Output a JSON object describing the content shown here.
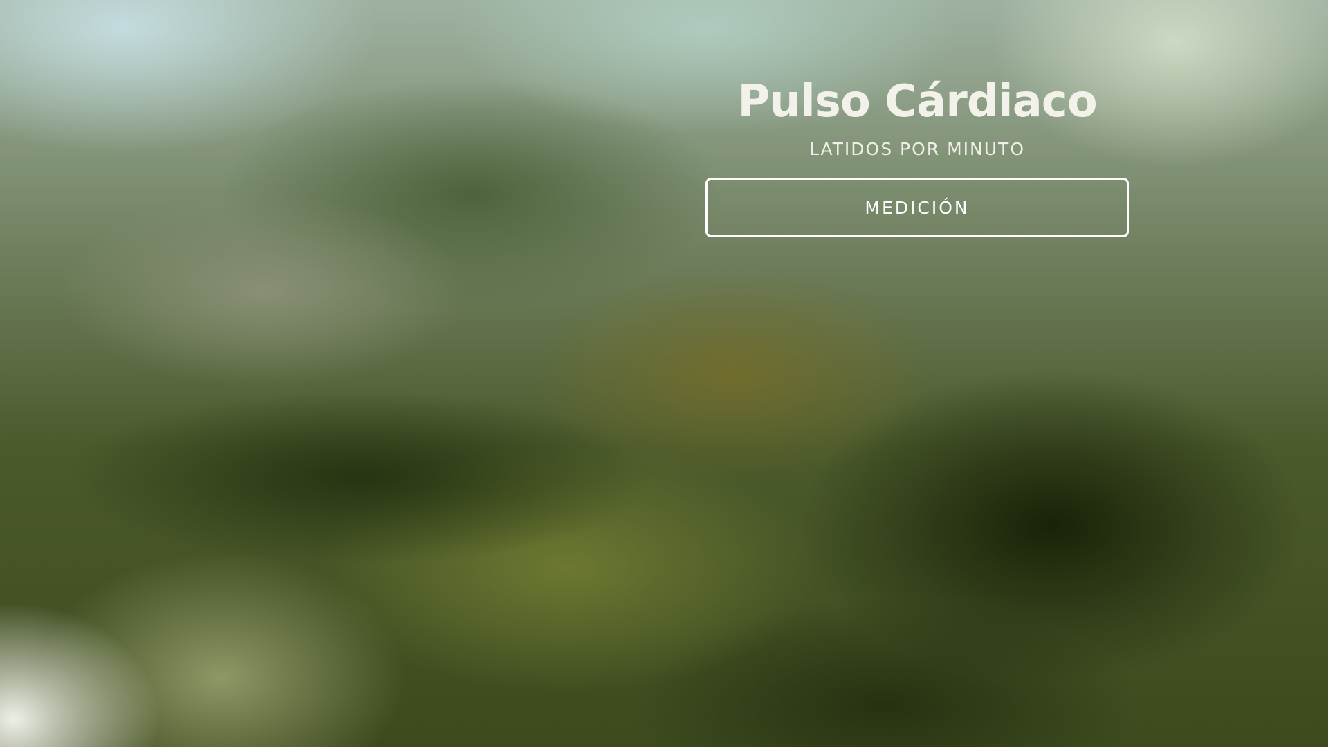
{
  "heart_rate": {
    "title": "Pulso Cárdiaco",
    "subtitle": "LATIDOS POR MINUTO",
    "measure_button_label": "MEDICIÓN"
  },
  "colors": {
    "text": "#f2f2ea",
    "button_border": "#ffffff",
    "background_dominant": "#4b5a2c"
  }
}
